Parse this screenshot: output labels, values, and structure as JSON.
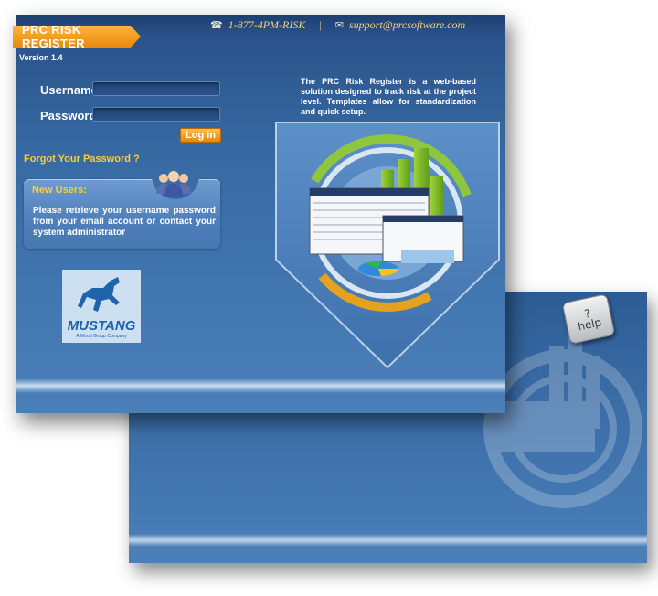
{
  "header": {
    "phone": "1-877-4PM-RISK",
    "separator": "|",
    "email": "support@prcsoftware.com"
  },
  "app": {
    "title": "PRC RISK REGISTER",
    "version": "Version 1.4"
  },
  "login": {
    "username_label": "Username",
    "password_label": "Password",
    "username_value": "",
    "password_value": "",
    "login_button": "Log in",
    "forgot_link": "Forgot Your Password ?"
  },
  "new_users": {
    "title": "New Users:",
    "text": "Please retrieve your username password from your email account or contact your system administrator"
  },
  "logo": {
    "name": "MUSTANG",
    "tagline": "A Wood Group Company"
  },
  "description": "The PRC Risk Register is a web-based solution designed to track risk at the project level. Templates allow for standardization and quick setup.",
  "help": {
    "symbol": "?",
    "label": "help"
  },
  "icons": {
    "phone": "phone-icon",
    "email": "email-icon",
    "users": "users-icon",
    "help": "help-icon"
  },
  "colors": {
    "accent_orange": "#f0a020",
    "link_yellow": "#ffcc33",
    "panel_blue": "#3c6ea8",
    "contact_gold": "#f3d27a"
  }
}
